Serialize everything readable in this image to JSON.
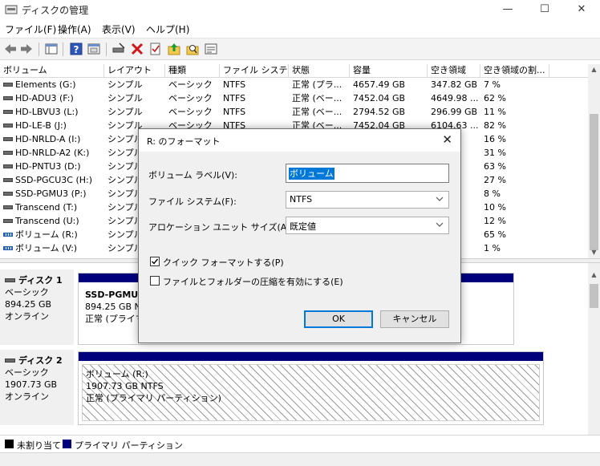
{
  "window": {
    "title": "ディスクの管理",
    "minimize": "—",
    "maximize": "☐",
    "close": "✕"
  },
  "menu": [
    "ファイル(F)",
    "操作(A)",
    "表示(V)",
    "ヘルプ(H)"
  ],
  "volume_list": {
    "columns": [
      "ボリューム",
      "レイアウト",
      "種類",
      "ファイル システム",
      "状態",
      "容量",
      "空き領域",
      "空き領域の割..."
    ],
    "rows": [
      [
        "Elements (G:)",
        "シンプル",
        "ベーシック",
        "NTFS",
        "正常 (プラ...",
        "4657.49 GB",
        "347.82 GB",
        "7 %"
      ],
      [
        "HD-ADU3 (F:)",
        "シンプル",
        "ベーシック",
        "NTFS",
        "正常 (ベー...",
        "7452.04 GB",
        "4649.98 ...",
        "62 %"
      ],
      [
        "HD-LBVU3 (L:)",
        "シンプル",
        "ベーシック",
        "NTFS",
        "正常 (ベー...",
        "2794.52 GB",
        "296.99 GB",
        "11 %"
      ],
      [
        "HD-LE-B (J:)",
        "シンプル",
        "ベーシック",
        "NTFS",
        "正常 (ベー...",
        "7452.04 GB",
        "6104.63 ...",
        "82 %"
      ],
      [
        "HD-NRLD-A (I:)",
        "シンプル",
        "",
        "",
        "",
        "",
        "",
        "16 %"
      ],
      [
        "HD-NRLD-A2 (K:)",
        "シンプル",
        "",
        "",
        "",
        "",
        "",
        "31 %"
      ],
      [
        "HD-PNTU3 (D:)",
        "シンプル",
        "",
        "",
        "",
        "",
        "",
        "63 %"
      ],
      [
        "SSD-PGCU3C (H:)",
        "シンプル",
        "",
        "",
        "",
        "",
        "",
        "27 %"
      ],
      [
        "SSD-PGMU3 (P:)",
        "シンプル",
        "",
        "",
        "",
        "",
        "",
        "8 %"
      ],
      [
        "Transcend (T:)",
        "シンプル",
        "",
        "",
        "",
        "",
        "",
        "10 %"
      ],
      [
        "Transcend (U:)",
        "シンプル",
        "",
        "",
        "",
        "",
        "",
        "12 %"
      ],
      [
        "ボリューム (R:)",
        "シンプル",
        "",
        "",
        "",
        "",
        "",
        "65 %"
      ],
      [
        "ボリューム (V:)",
        "シンプル",
        "",
        "",
        "",
        "",
        "",
        "1 %"
      ]
    ]
  },
  "disks": [
    {
      "name": "ディスク 1",
      "type": "ベーシック",
      "size": "894.25 GB",
      "status": "オンライン",
      "partition_name": "SSD-PGMU3",
      "partition_size": "894.25 GB NTF",
      "partition_status": "正常 (プライマ"
    },
    {
      "name": "ディスク 2",
      "type": "ベーシック",
      "size": "1907.73 GB",
      "status": "オンライン",
      "partition_name": "ボリューム (R:)",
      "partition_size": "1907.73 GB NTFS",
      "partition_status": "正常 (プライマリ パーティション)"
    }
  ],
  "legend": {
    "unallocated": "未割り当て",
    "primary": "プライマリ パーティション",
    "unallocated_color": "#000000",
    "primary_color": "#00007d"
  },
  "dialog": {
    "title": "R: のフォーマット",
    "close": "✕",
    "volume_label_caption": "ボリューム ラベル(V):",
    "volume_label_value": "ボリューム",
    "filesystem_caption": "ファイル システム(F):",
    "filesystem_value": "NTFS",
    "allocation_caption": "アロケーション ユニット サイズ(A):",
    "allocation_value": "既定値",
    "quick_format_label": "クイック フォーマットする(P)",
    "quick_format_checked": true,
    "compression_label": "ファイルとフォルダーの圧縮を有効にする(E)",
    "compression_checked": false,
    "ok": "OK",
    "cancel": "キャンセル"
  }
}
